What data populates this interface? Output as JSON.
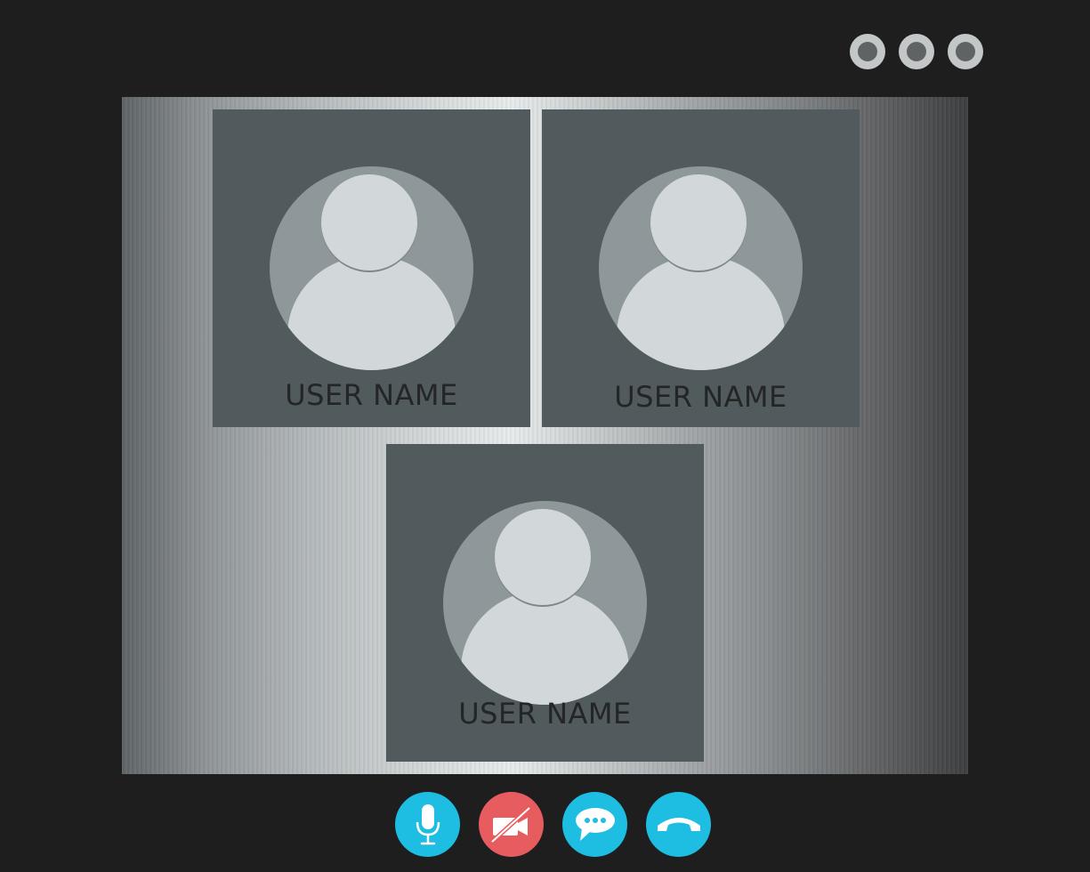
{
  "window": {
    "controls": [
      {
        "icon": "window-dot-icon"
      },
      {
        "icon": "window-dot-icon"
      },
      {
        "icon": "window-dot-icon"
      }
    ]
  },
  "participants": [
    {
      "name": "USER NAME",
      "icon": "user-avatar-icon"
    },
    {
      "name": "USER NAME",
      "icon": "user-avatar-icon"
    },
    {
      "name": "USER NAME",
      "icon": "user-avatar-icon"
    }
  ],
  "call_controls": [
    {
      "icon": "microphone-icon",
      "color": "#1ebde2"
    },
    {
      "icon": "camera-off-icon",
      "color": "#e75c5f"
    },
    {
      "icon": "chat-icon",
      "color": "#1ebde2"
    },
    {
      "icon": "hang-up-icon",
      "color": "#1ebde2"
    }
  ],
  "colors": {
    "background": "#1f1e1f",
    "tile": "#515a5c",
    "avatar_bg": "#8e9799",
    "avatar_fg": "#d2d8d9",
    "accent_blue": "#1ebde2",
    "accent_red": "#e75c5f"
  }
}
